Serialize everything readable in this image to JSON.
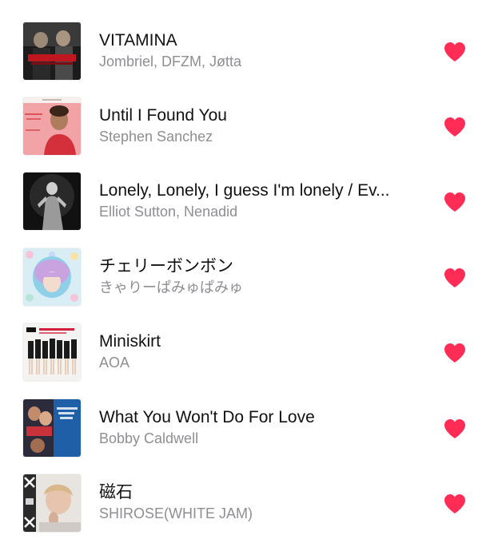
{
  "accent_color": "#ff2d55",
  "songs": [
    {
      "title": "VITAMINA",
      "artist": "Jombriel, DFZM, Jøtta",
      "art_icon": "vitamina-artwork",
      "loved": true
    },
    {
      "title": "Until I Found You",
      "artist": "Stephen Sanchez",
      "art_icon": "until-i-found-you-artwork",
      "loved": true
    },
    {
      "title": "Lonely, Lonely, I guess I'm lonely / Ev...",
      "artist": "Elliot Sutton, Nenadid",
      "art_icon": "lonely-artwork",
      "loved": true
    },
    {
      "title": "チェリーボンボン",
      "artist": "きゃりーぱみゅぱみゅ",
      "art_icon": "cherry-bonbon-artwork",
      "loved": true
    },
    {
      "title": "Miniskirt",
      "artist": "AOA",
      "art_icon": "miniskirt-artwork",
      "loved": true
    },
    {
      "title": "What You Won't Do For Love",
      "artist": "Bobby Caldwell",
      "art_icon": "what-you-wont-do-artwork",
      "loved": true
    },
    {
      "title": "磁石",
      "artist": "SHIROSE(WHITE JAM)",
      "art_icon": "jishaku-artwork",
      "loved": true
    }
  ]
}
